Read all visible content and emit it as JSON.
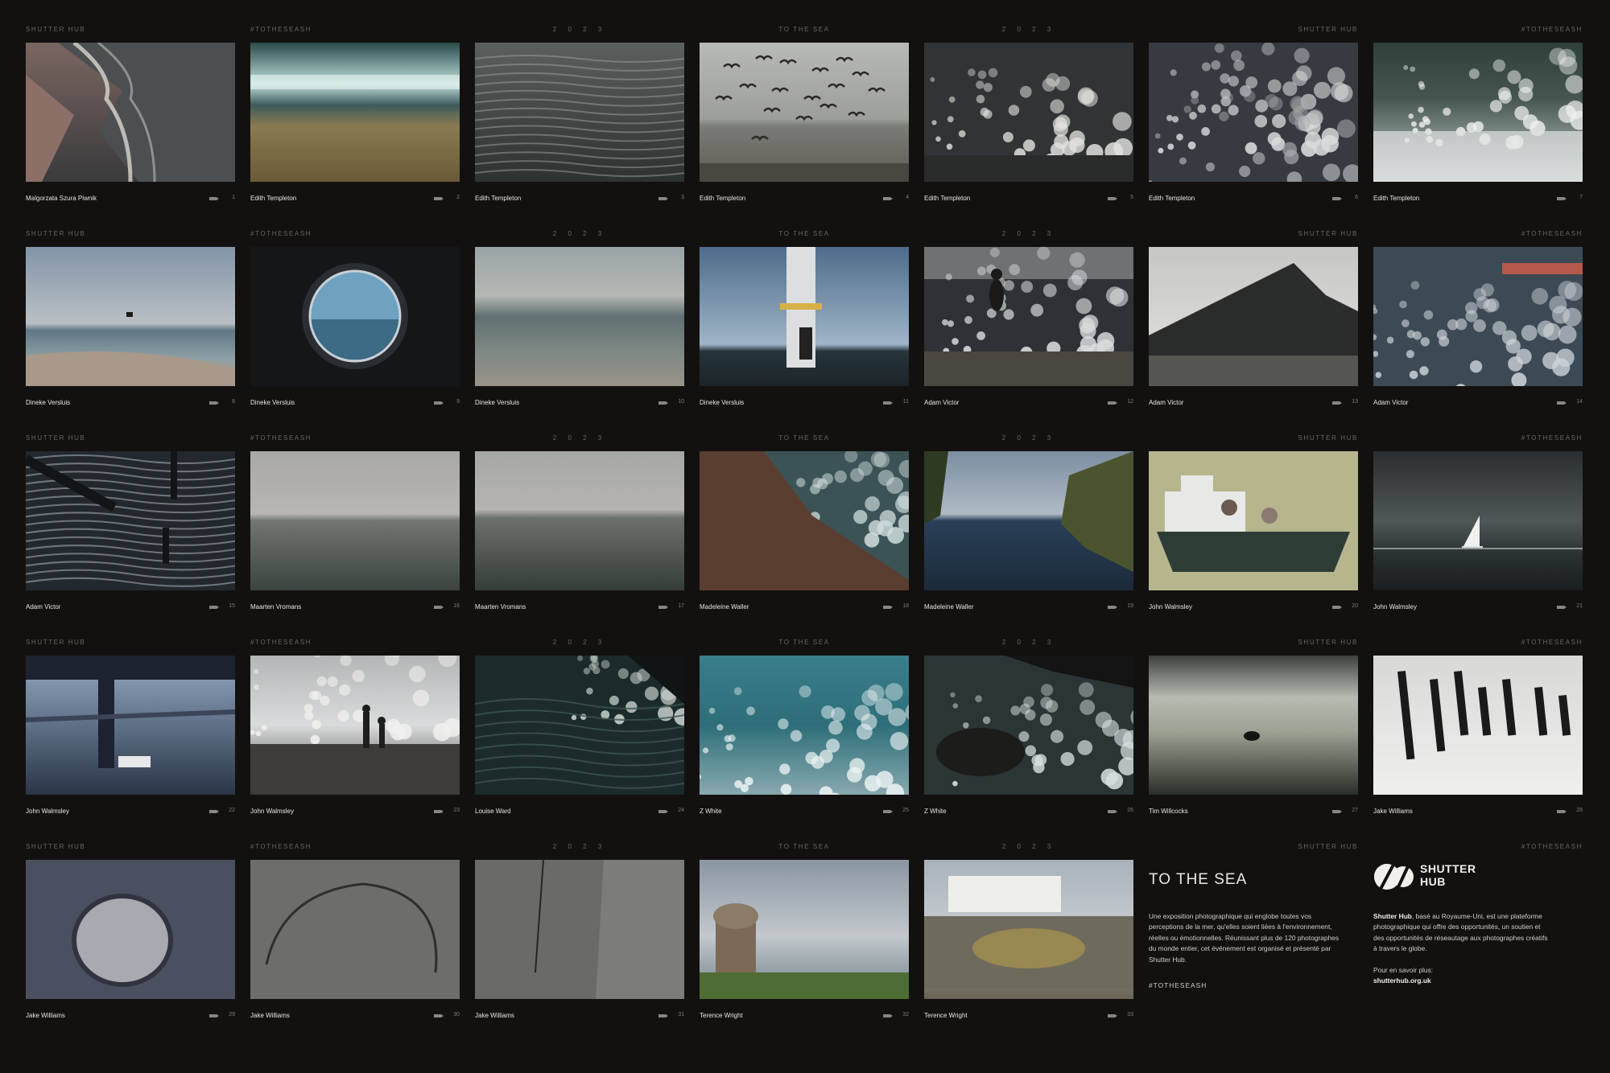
{
  "header_labels": [
    "SHUTTER HUB",
    "#TOTHESEASH",
    "2 0 2 3",
    "TO THE SEA",
    "2 0 2 3",
    "SHUTTER HUB",
    "#TOTHESEASH"
  ],
  "photos": [
    {
      "photographer": "Malgorzata Szura Piwnik",
      "number": "1",
      "subject": "aerial-beach-waves"
    },
    {
      "photographer": "Edith Templeton",
      "number": "2",
      "subject": "motion-blur-wave"
    },
    {
      "photographer": "Edith Templeton",
      "number": "3",
      "subject": "rippled-water"
    },
    {
      "photographer": "Edith Templeton",
      "number": "4",
      "subject": "gulls-over-sea"
    },
    {
      "photographer": "Edith Templeton",
      "number": "5",
      "subject": "breaking-wave"
    },
    {
      "photographer": "Edith Templeton",
      "number": "6",
      "subject": "crashing-surf"
    },
    {
      "photographer": "Edith Templeton",
      "number": "7",
      "subject": "wave-spray"
    },
    {
      "photographer": "Dineke Versluis",
      "number": "8",
      "subject": "calm-beach-dusk"
    },
    {
      "photographer": "Dineke Versluis",
      "number": "9",
      "subject": "porthole-view"
    },
    {
      "photographer": "Dineke Versluis",
      "number": "10",
      "subject": "blurred-shore"
    },
    {
      "photographer": "Dineke Versluis",
      "number": "11",
      "subject": "turbine-tower"
    },
    {
      "photographer": "Adam Victor",
      "number": "12",
      "subject": "jumping-figure"
    },
    {
      "photographer": "Adam Victor",
      "number": "13",
      "subject": "cliff-coast"
    },
    {
      "photographer": "Adam Victor",
      "number": "14",
      "subject": "stormy-shore"
    },
    {
      "photographer": "Adam Victor",
      "number": "15",
      "subject": "pier-reflections"
    },
    {
      "photographer": "Maarten Vromans",
      "number": "16",
      "subject": "misty-horizon"
    },
    {
      "photographer": "Maarten Vromans",
      "number": "17",
      "subject": "misty-horizon-2"
    },
    {
      "photographer": "Madeleine Waller",
      "number": "18",
      "subject": "rocky-slope-sea"
    },
    {
      "photographer": "Madeleine Waller",
      "number": "19",
      "subject": "lagoon-swimmer"
    },
    {
      "photographer": "John Walmsley",
      "number": "20",
      "subject": "toy-boat-ride"
    },
    {
      "photographer": "John Walmsley",
      "number": "21",
      "subject": "sailboat-storm"
    },
    {
      "photographer": "John Walmsley",
      "number": "22",
      "subject": "ferry-window"
    },
    {
      "photographer": "John Walmsley",
      "number": "23",
      "subject": "couple-watching-waves"
    },
    {
      "photographer": "Louise Ward",
      "number": "24",
      "subject": "dark-surf"
    },
    {
      "photographer": "Z  White",
      "number": "25",
      "subject": "green-wave"
    },
    {
      "photographer": "Z White",
      "number": "26",
      "subject": "rocks-foam"
    },
    {
      "photographer": "Tim Willcocks",
      "number": "27",
      "subject": "swimmer-long-exposure"
    },
    {
      "photographer": "Jake Williams",
      "number": "28",
      "subject": "beach-posts-bw"
    },
    {
      "photographer": "Jake Williams",
      "number": "29",
      "subject": "pebble-rock"
    },
    {
      "photographer": "Jake Williams",
      "number": "30",
      "subject": "sand-texture"
    },
    {
      "photographer": "Jake Williams",
      "number": "31",
      "subject": "concrete-corner"
    },
    {
      "photographer": "Terence Wright",
      "number": "32",
      "subject": "temple-on-cliff"
    },
    {
      "photographer": "Terence Wright",
      "number": "33",
      "subject": "caravan-mural"
    }
  ],
  "exhibition": {
    "title": "TO THE SEA",
    "description_lines": [
      "Une exposition photographique qui englobe toutes vos",
      "perceptions de la mer, qu'elles soient liées à l'environnement,",
      "réelles ou émotionnelles. Réunissant plus de 120 photographes",
      "du monde entier, cet événement est organisé et présenté par",
      "Shutter Hub."
    ],
    "hashtag": "#TOTHESEASH"
  },
  "organiser": {
    "logo_line1": "SHUTTER",
    "logo_line2": "HUB",
    "about_name": "Shutter Hub",
    "about_lines": [
      ", basé au Royaume-Uni, est une plateforme",
      "photographique qui offre des opportunités, un soutien et",
      "des opportunités de réseautage aux photographes créatifs",
      "à travers le globe."
    ],
    "more_label": "Pour en savoir plus:",
    "url": "shutterhub.org.uk"
  },
  "colors": {
    "background": "#131110",
    "header_text": "#6a6560",
    "caption_text": "#e9e6e1"
  }
}
